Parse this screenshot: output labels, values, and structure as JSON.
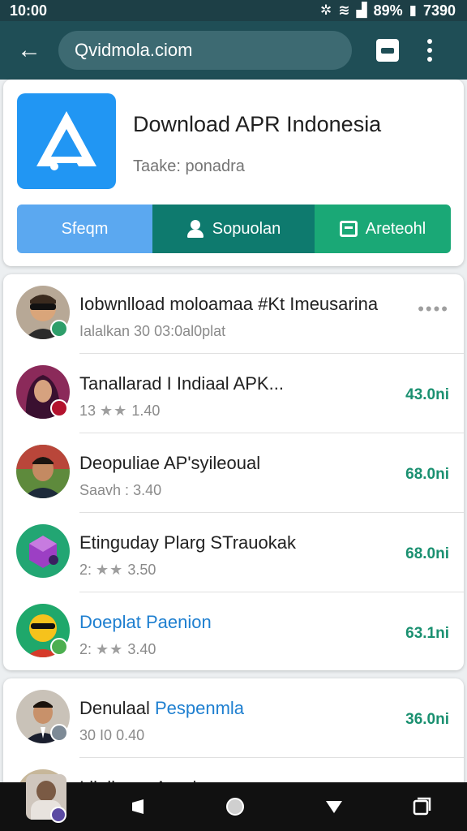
{
  "status_bar": {
    "time": "10:00",
    "battery": "89%",
    "clock_right": "7390",
    "icons": [
      "bluetooth-icon",
      "wifi-icon",
      "signal-icon"
    ]
  },
  "toolbar": {
    "url": "Qvidmola.ciom",
    "icons": [
      "back-arrow-icon",
      "tabs-icon",
      "more-vert-icon"
    ]
  },
  "header": {
    "title": "Download APR Indonesia",
    "subtitle": "Taake: ponadra",
    "buttons": [
      {
        "label": "Sfeqm"
      },
      {
        "label": "Sopuolan"
      },
      {
        "label": "Areteohl"
      }
    ]
  },
  "list": [
    {
      "title": "Iobwnlload moloamaa #Kt Imeusarina",
      "sub": "Ialalkan 30 03:0al0plat",
      "action": "••••"
    },
    {
      "title": "Tanallarad I Indiaal APK...",
      "sub_prefix": "13",
      "stars": "★★",
      "sub_value": "1.40",
      "size": "43.0ni"
    },
    {
      "title": "Deopuliae AP'syileoual",
      "sub_prefix": "Saavh :",
      "stars": "",
      "sub_value": "3.40",
      "size": "68.0ni"
    },
    {
      "title": "Etinguday Plarg STrauokak",
      "sub_prefix": "2:",
      "stars": "★★",
      "sub_value": "3.50",
      "size": "68.0ni"
    },
    {
      "title": "Doeplat Paenion",
      "sub_prefix": "2:",
      "stars": "★★",
      "sub_value": "3.40",
      "size": "63.1ni"
    }
  ],
  "list2": [
    {
      "title_a": "Denulaal",
      "title_b": "Pespenmla",
      "sub_prefix": "30 I0",
      "stars": "",
      "sub_value": "0.40",
      "size": "36.0ni"
    },
    {
      "title": "Lllolhana Aeeriem"
    }
  ],
  "colors": {
    "app_bar": "#1f4e56",
    "accent_blue": "#2196f3",
    "teal": "#0e7a6e",
    "green": "#1aa876",
    "size_green": "#1a9070"
  }
}
